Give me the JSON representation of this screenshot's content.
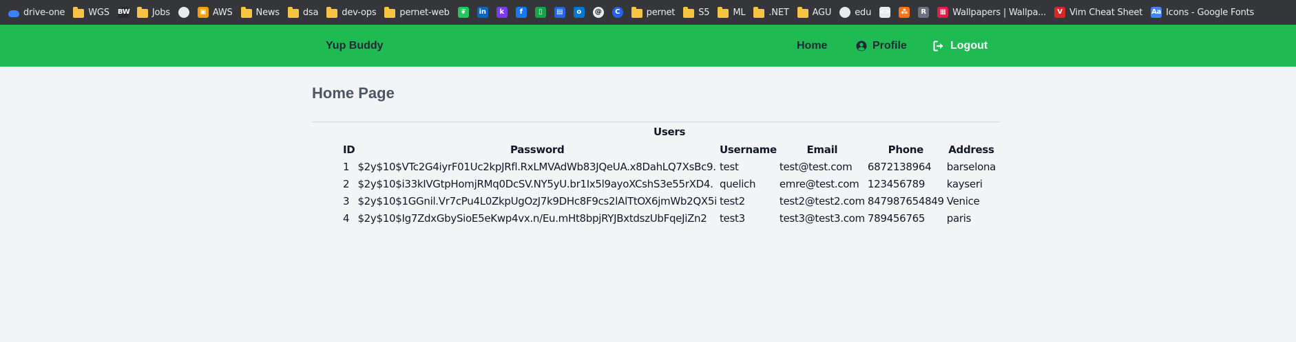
{
  "bookmarks": [
    {
      "label": "drive-one",
      "icon": "cloud-icon",
      "color": "#3b82f6"
    },
    {
      "label": "WGS",
      "icon": "folder-icon"
    },
    {
      "label": "",
      "icon": "ide-icon",
      "color": "#2b2b2b",
      "glyph": "BW"
    },
    {
      "label": "Jobs",
      "icon": "folder-icon"
    },
    {
      "label": "",
      "icon": "github-icon",
      "color": "#e8eaed",
      "glyph": "●"
    },
    {
      "label": "AWS",
      "icon": "aws-box-icon",
      "color": "#f59e0b",
      "glyph": "▣"
    },
    {
      "label": "News",
      "icon": "folder-icon"
    },
    {
      "label": "dsa",
      "icon": "folder-icon"
    },
    {
      "label": "dev-ops",
      "icon": "folder-icon"
    },
    {
      "label": "pernet-web",
      "icon": "folder-icon"
    },
    {
      "label": "",
      "icon": "leaf-icon",
      "color": "#22c55e",
      "glyph": "❦"
    },
    {
      "label": "",
      "icon": "linkedin-icon",
      "color": "#0a66c2",
      "glyph": "in"
    },
    {
      "label": "",
      "icon": "k-icon",
      "color": "#7c3aed",
      "glyph": "k"
    },
    {
      "label": "",
      "icon": "facebook-icon",
      "color": "#1877f2",
      "glyph": "f"
    },
    {
      "label": "",
      "icon": "phone-icon",
      "color": "#16a34a",
      "glyph": "▯"
    },
    {
      "label": "",
      "icon": "trello-icon",
      "color": "#2563eb",
      "glyph": "▤"
    },
    {
      "label": "",
      "icon": "outlook-icon",
      "color": "#0078d4",
      "glyph": "o"
    },
    {
      "label": "",
      "icon": "threads-icon",
      "color": "#e8eaed",
      "glyph": "@"
    },
    {
      "label": "",
      "icon": "c-icon",
      "color": "#2563eb",
      "glyph": "C"
    },
    {
      "label": "pernet",
      "icon": "folder-icon"
    },
    {
      "label": "S5",
      "icon": "folder-icon"
    },
    {
      "label": "ML",
      "icon": "folder-icon"
    },
    {
      "label": ".NET",
      "icon": "folder-icon"
    },
    {
      "label": "AGU",
      "icon": "folder-icon"
    },
    {
      "label": "edu",
      "icon": "github-icon",
      "color": "#e8eaed",
      "glyph": "●"
    },
    {
      "label": "",
      "icon": "code-icon",
      "color": "#e8eaed",
      "glyph": "<>"
    },
    {
      "label": "",
      "icon": "people-icon",
      "color": "#f97316",
      "glyph": "⁂"
    },
    {
      "label": "",
      "icon": "r-icon",
      "color": "#6b7280",
      "glyph": "R"
    },
    {
      "label": "Wallpapers | Wallpa...",
      "icon": "wallpapers-icon",
      "color": "#e11d48",
      "glyph": "▦"
    },
    {
      "label": "Vim Cheat Sheet",
      "icon": "vim-icon",
      "color": "#dc2626",
      "glyph": "V"
    },
    {
      "label": "Icons - Google Fonts",
      "icon": "google-fonts-icon",
      "color": "#4285f4",
      "glyph": "Aa"
    }
  ],
  "navbar": {
    "brand": "Yup Buddy",
    "home": "Home",
    "profile": "Profile",
    "logout": "Logout",
    "bg_color": "#1fbb52"
  },
  "main": {
    "page_title": "Home Page",
    "table": {
      "caption": "Users",
      "columns": [
        "ID",
        "Password",
        "Username",
        "Email",
        "Phone",
        "Address"
      ],
      "rows": [
        [
          "1",
          "$2y$10$VTc2G4iyrF01Uc2kpJRfl.RxLMVAdWb83JQeUA.x8DahLQ7XsBc9.",
          "test",
          "test@test.com",
          "6872138964",
          "barselona"
        ],
        [
          "2",
          "$2y$10$i33kIVGtpHomjRMq0DcSV.NY5yU.br1Ix5l9ayoXCshS3e55rXD4.",
          "quelich",
          "emre@test.com",
          "123456789",
          "kayseri"
        ],
        [
          "3",
          "$2y$10$1GGnil.Vr7cPu4L0ZkpUgOzJ7k9DHc8F9cs2lAlTtOX6jmWb2QX5i",
          "test2",
          "test2@test2.com",
          "847987654849",
          "Venice"
        ],
        [
          "4",
          "$2y$10$Ig7ZdxGbySioE5eKwp4vx.n/Eu.mHt8bpjRYJBxtdszUbFqeJiZn2",
          "test3",
          "test3@test3.com",
          "789456765",
          "paris"
        ]
      ]
    }
  }
}
